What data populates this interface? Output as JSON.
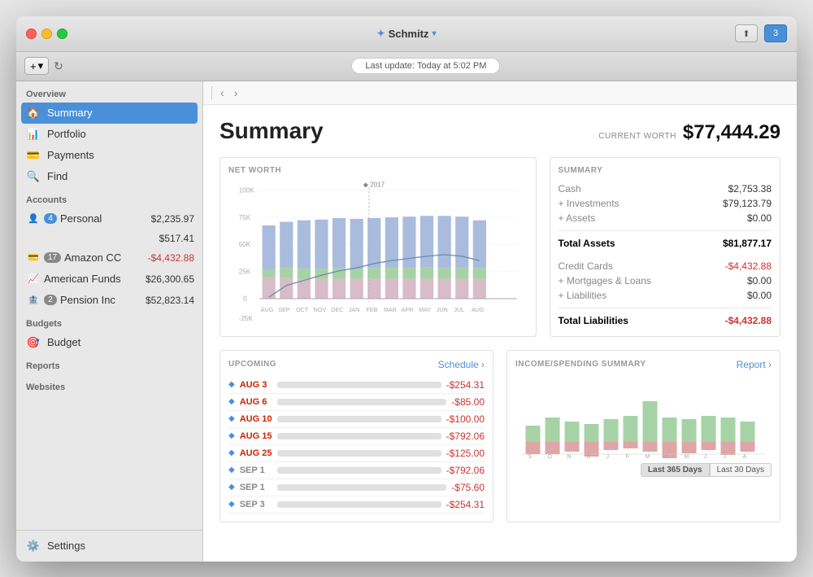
{
  "window": {
    "title": "Schmitz",
    "toolbar": {
      "add_label": "+",
      "chevron_label": "›",
      "update_text": "Last update:  Today at 5:02 PM"
    }
  },
  "sidebar": {
    "overview_label": "Overview",
    "items_overview": [
      {
        "id": "summary",
        "label": "Summary",
        "icon": "🏠",
        "active": true
      },
      {
        "id": "portfolio",
        "label": "Portfolio",
        "icon": "📊",
        "active": false
      },
      {
        "id": "payments",
        "label": "Payments",
        "icon": "💳",
        "active": false
      },
      {
        "id": "find",
        "label": "Find",
        "icon": "🔍",
        "active": false
      }
    ],
    "accounts_label": "Accounts",
    "accounts": [
      {
        "id": "personal",
        "label": "Personal",
        "badge": "4",
        "badge_color": "blue",
        "amount": "$2,235.97",
        "negative": false
      },
      {
        "id": "account2",
        "label": "",
        "badge": "",
        "amount": "$517.41",
        "negative": false
      },
      {
        "id": "amazon",
        "label": "Amazon CC",
        "badge": "17",
        "badge_color": "normal",
        "amount": "-$4,432.88",
        "negative": true
      },
      {
        "id": "american",
        "label": "American Funds",
        "badge": "",
        "amount": "$26,300.65",
        "negative": false
      },
      {
        "id": "pension",
        "label": "Pension Inc",
        "badge": "2",
        "badge_color": "normal",
        "amount": "$52,823.14",
        "negative": false
      }
    ],
    "budgets_label": "Budgets",
    "budget_item": {
      "id": "budget",
      "label": "Budget",
      "icon": "🎯"
    },
    "reports_label": "Reports",
    "websites_label": "Websites",
    "settings_label": "Settings"
  },
  "content": {
    "page_title": "Summary",
    "worth_label": "CURRENT WORTH",
    "worth_value": "$77,444.29",
    "net_worth_label": "NET WORTH",
    "summary_label": "SUMMARY",
    "year_marker": "2017",
    "chart_y_labels": [
      "100K",
      "75K",
      "50K",
      "25K",
      "0",
      "-25K"
    ],
    "chart_x_labels": [
      "AUG",
      "SEP",
      "OCT",
      "NOV",
      "DEC",
      "JAN",
      "FEB",
      "MAR",
      "APR",
      "MAY",
      "JUN",
      "JUL",
      "AUG"
    ],
    "summary_rows": [
      {
        "label": "Cash",
        "value": "$2,753.38",
        "negative": false
      },
      {
        "label": "+ Investments",
        "value": "$79,123.79",
        "negative": false
      },
      {
        "label": "+ Assets",
        "value": "$0.00",
        "negative": false
      },
      {
        "label": "Total Assets",
        "value": "$81,877.17",
        "negative": false,
        "bold": true
      }
    ],
    "summary_rows2": [
      {
        "label": "Credit Cards",
        "value": "-$4,432.88",
        "negative": true
      },
      {
        "label": "+ Mortgages & Loans",
        "value": "$0.00",
        "negative": false
      },
      {
        "label": "+ Liabilities",
        "value": "$0.00",
        "negative": false
      },
      {
        "label": "Total Liabilities",
        "value": "-$4,432.88",
        "negative": true,
        "bold": true
      }
    ],
    "upcoming_label": "UPCOMING",
    "schedule_label": "Schedule ›",
    "upcoming_items": [
      {
        "date": "AUG 3",
        "amount": "-$254.31"
      },
      {
        "date": "AUG 6",
        "amount": "-$85.00"
      },
      {
        "date": "AUG 10",
        "amount": "-$100.00"
      },
      {
        "date": "AUG 15",
        "amount": "-$792.06"
      },
      {
        "date": "AUG 25",
        "amount": "-$125.00"
      },
      {
        "date": "SEP 1",
        "amount": "-$792.06"
      },
      {
        "date": "SEP 1",
        "amount": "-$75.60"
      },
      {
        "date": "SEP 3",
        "amount": "-$254.31"
      }
    ],
    "income_label": "INCOME/SPENDING SUMMARY",
    "report_label": "Report ›",
    "income_x_labels": [
      "S",
      "O",
      "N",
      "D",
      "J",
      "F",
      "M",
      "A",
      "M",
      "J",
      "J",
      "A"
    ],
    "period_btns": [
      "Last 365 Days",
      "Last 30 Days"
    ]
  }
}
